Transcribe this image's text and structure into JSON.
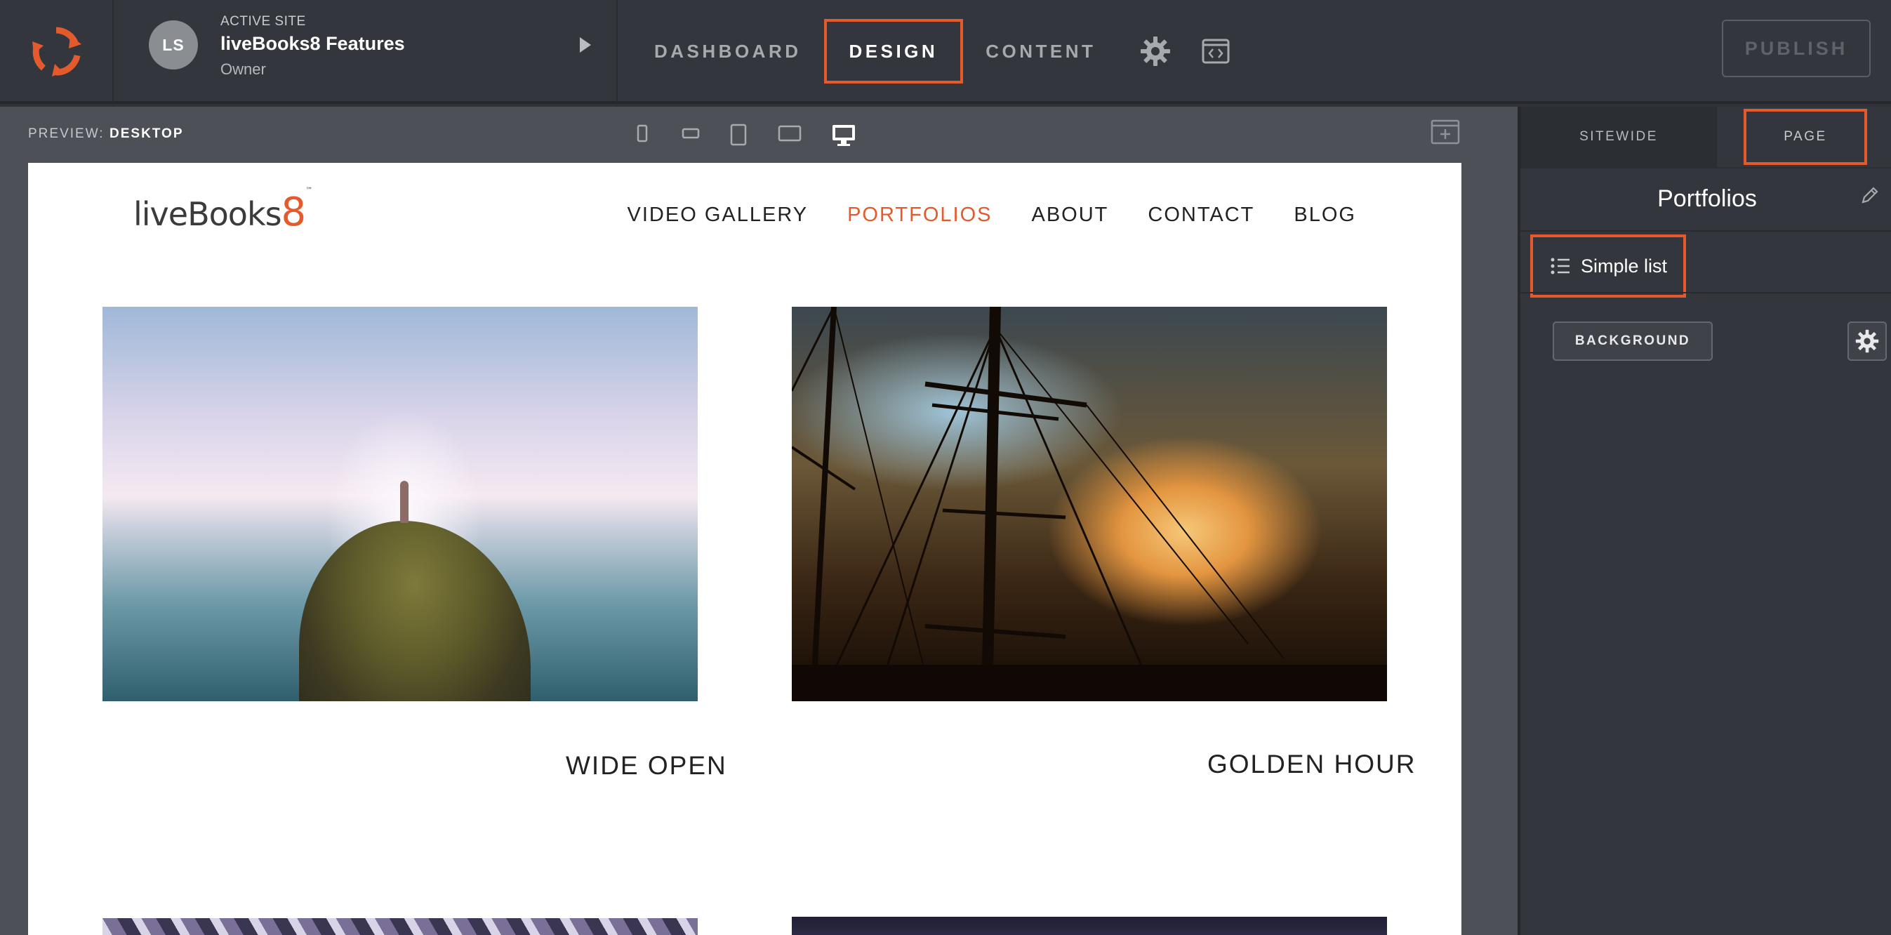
{
  "app": {
    "active_site_label": "ACTIVE SITE",
    "site_name": "liveBooks8 Features",
    "site_role": "Owner",
    "avatar_initials": "LS",
    "nav": [
      {
        "label": "DASHBOARD"
      },
      {
        "label": "DESIGN",
        "active": true
      },
      {
        "label": "CONTENT"
      }
    ],
    "publish_label": "PUBLISH",
    "accent_color": "#e45a2c"
  },
  "preview": {
    "label": "PREVIEW:",
    "value": "DESKTOP",
    "devices": [
      "phone-portrait-icon",
      "phone-landscape-icon",
      "tablet-portrait-icon",
      "tablet-landscape-icon",
      "desktop-icon"
    ]
  },
  "site": {
    "logo_text": "liveBoo",
    "logo_tail": "ks",
    "logo_mark": "8",
    "logo_tm": "™",
    "nav": [
      "VIDEO GALLERY",
      "PORTFOLIOS",
      "ABOUT",
      "CONTACT",
      "BLOG"
    ],
    "current_nav": "PORTFOLIOS",
    "galleries": [
      {
        "caption": "WIDE OPEN"
      },
      {
        "caption": "GOLDEN HOUR"
      }
    ]
  },
  "panel": {
    "tabs": [
      "SITEWIDE",
      "PAGE"
    ],
    "active_tab": "PAGE",
    "title": "Portfolios",
    "layout_label": "Simple list",
    "background_button": "BACKGROUND"
  }
}
